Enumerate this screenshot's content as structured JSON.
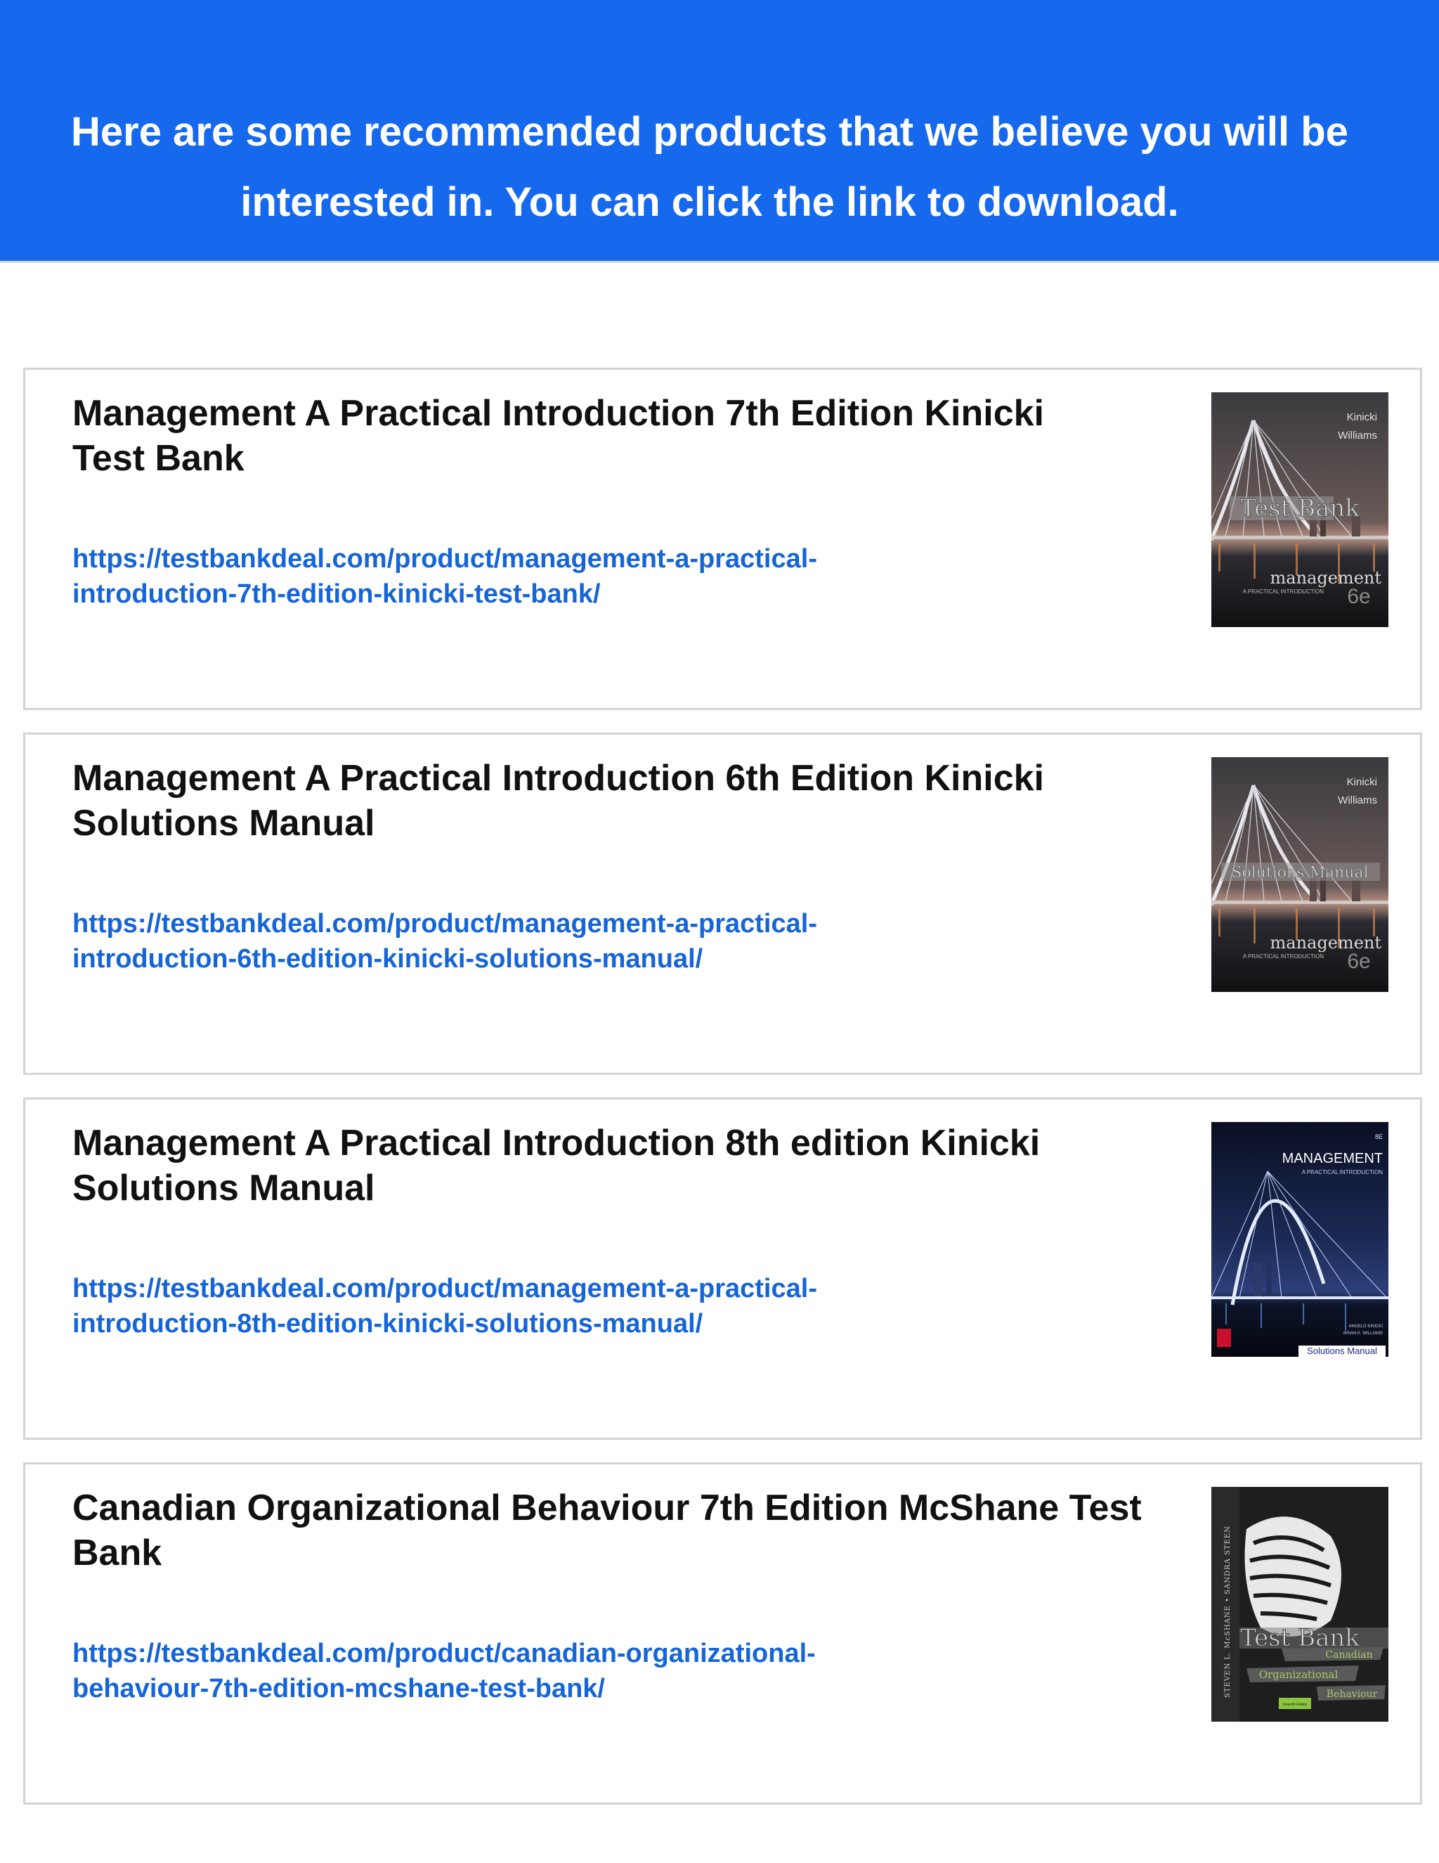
{
  "banner": {
    "line1": "Here are some recommended products that we believe you will be",
    "line2": "interested in. You can click the link to download."
  },
  "products": [
    {
      "title_line1": "Management A Practical Introduction 7th Edition Kinicki",
      "title_line2": "Test Bank",
      "link_line1": "https://testbankdeal.com/product/management-a-practical-",
      "link_line2": "introduction-7th-edition-kinicki-test-bank/",
      "cover": {
        "authors1": "Kinicki",
        "authors2": "Williams",
        "stamp": "Test Bank",
        "title": "management",
        "subtitle": "A PRACTICAL INTRODUCTION",
        "edition": "6e"
      }
    },
    {
      "title_line1": "Management A Practical Introduction 6th Edition Kinicki",
      "title_line2": "Solutions Manual",
      "link_line1": "https://testbankdeal.com/product/management-a-practical-",
      "link_line2": "introduction-6th-edition-kinicki-solutions-manual/",
      "cover": {
        "authors1": "Kinicki",
        "authors2": "Williams",
        "stamp": "Solutions Manual",
        "title": "management",
        "subtitle": "A PRACTICAL INTRODUCTION",
        "edition": "6e"
      }
    },
    {
      "title_line1": "Management A Practical Introduction 8th edition Kinicki",
      "title_line2": "Solutions Manual",
      "link_line1": "https://testbankdeal.com/product/management-a-practical-",
      "link_line2": "introduction-8th-edition-kinicki-solutions-manual/",
      "cover": {
        "edition": "8E",
        "title": "MANAGEMENT",
        "subtitle": "A PRACTICAL INTRODUCTION",
        "author1": "ANGELO KINICKI",
        "author2": "BRIAN K. WILLIAMS",
        "stamp": "Solutions Manual"
      }
    },
    {
      "title_line1": "Canadian Organizational Behaviour 7th Edition McShane Test",
      "title_line2": "Bank",
      "link_line1": "https://testbankdeal.com/product/canadian-organizational-",
      "link_line2": "behaviour-7th-edition-mcshane-test-bank/",
      "cover": {
        "spine": "STEVEN L. McSHANE  •  SANDRA STEEN",
        "stamp": "Test Bank",
        "word1": "Canadian",
        "word2": "Organizational",
        "word3": "Behaviour",
        "edition": "Seventh Edition"
      }
    }
  ],
  "colors": {
    "banner": "#1668ec",
    "link": "#1565d8"
  }
}
